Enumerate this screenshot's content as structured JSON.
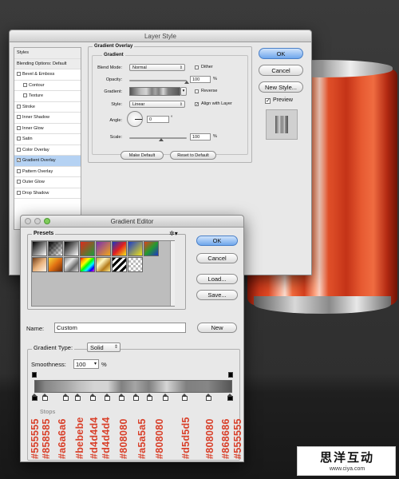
{
  "layer_style": {
    "title": "Layer Style",
    "styles_list": [
      {
        "label": "Styles",
        "type": "header"
      },
      {
        "label": "Blending Options: Default",
        "type": "header"
      },
      {
        "label": "Bevel & Emboss",
        "checked": false
      },
      {
        "label": "Contour",
        "checked": false,
        "indent": true
      },
      {
        "label": "Texture",
        "checked": false,
        "indent": true
      },
      {
        "label": "Stroke",
        "checked": false
      },
      {
        "label": "Inner Shadow",
        "checked": false
      },
      {
        "label": "Inner Glow",
        "checked": false
      },
      {
        "label": "Satin",
        "checked": false
      },
      {
        "label": "Color Overlay",
        "checked": false
      },
      {
        "label": "Gradient Overlay",
        "checked": true,
        "selected": true
      },
      {
        "label": "Pattern Overlay",
        "checked": false
      },
      {
        "label": "Outer Glow",
        "checked": false
      },
      {
        "label": "Drop Shadow",
        "checked": false
      }
    ],
    "group_title": "Gradient Overlay",
    "subgroup_title": "Gradient",
    "blend_mode_label": "Blend Mode:",
    "blend_mode_value": "Normal",
    "dither_label": "Dither",
    "opacity_label": "Opacity:",
    "opacity_value": "100",
    "opacity_unit": "%",
    "gradient_label": "Gradient:",
    "reverse_label": "Reverse",
    "style_label": "Style:",
    "style_value": "Linear",
    "align_label": "Align with Layer",
    "angle_label": "Angle:",
    "angle_value": "0",
    "angle_unit": "°",
    "scale_label": "Scale:",
    "scale_value": "100",
    "scale_unit": "%",
    "make_default": "Make Default",
    "reset_default": "Reset to Default",
    "ok": "OK",
    "cancel": "Cancel",
    "new_style": "New Style...",
    "preview_label": "Preview",
    "preview_checked": true
  },
  "gradient_editor": {
    "title": "Gradient Editor",
    "presets_label": "Presets",
    "ok": "OK",
    "cancel": "Cancel",
    "load": "Load...",
    "save": "Save...",
    "name_label": "Name:",
    "name_value": "Custom",
    "new_button": "New",
    "gradient_type_label": "Gradient Type:",
    "gradient_type_value": "Solid",
    "smoothness_label": "Smoothness:",
    "smoothness_value": "100",
    "smoothness_unit": "%",
    "stops_label": "Stops",
    "stop_colors": [
      "#555555",
      "#858585",
      "#a6a6a6",
      "#bebebe",
      "#d4d4d4",
      "#d4d4d4",
      "#808080",
      "#a5a5a5",
      "#808080",
      "#d5d5d5",
      "#808080",
      "#868686",
      "#555555"
    ]
  },
  "watermark": {
    "chinese": "思洋互动",
    "url": "www.ciya.com"
  }
}
